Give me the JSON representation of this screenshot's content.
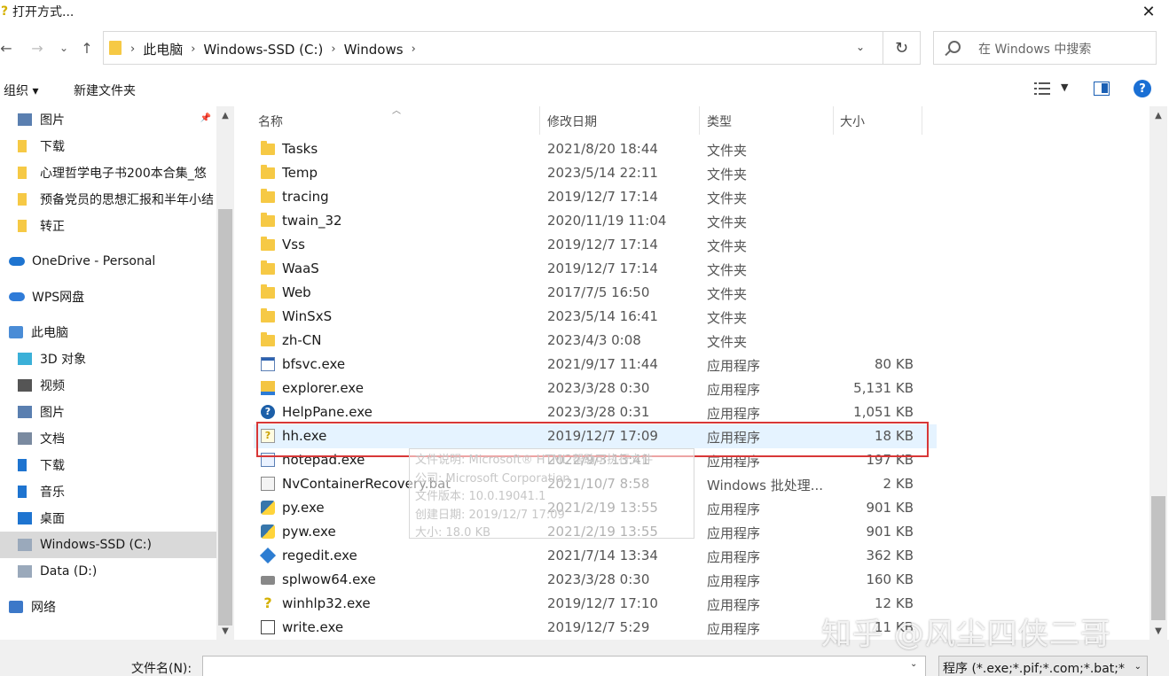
{
  "window": {
    "title": "打开方式...",
    "close_glyph": "✕"
  },
  "nav": {
    "back_glyph": "←",
    "forward_glyph": "→",
    "recent_glyph": "⌄",
    "up_glyph": "↑",
    "breadcrumbs": [
      "此电脑",
      "Windows-SSD (C:)",
      "Windows"
    ],
    "separator": "›",
    "refresh_glyph": "↻",
    "search_placeholder": "在 Windows 中搜索"
  },
  "toolbar": {
    "organize": "组织 ▾",
    "new_folder": "新建文件夹",
    "help": "?"
  },
  "sidebar": {
    "items": [
      {
        "label": "图片",
        "icon": "pictures-icon",
        "color": "#5a7fb0"
      },
      {
        "label": "下载",
        "icon": "folder-icon",
        "color": "#f6c945"
      },
      {
        "label": "心理哲学电子书200本合集_悠",
        "icon": "folder-icon",
        "color": "#f6c945"
      },
      {
        "label": "预备党员的思想汇报和半年小结",
        "icon": "folder-icon",
        "color": "#f6c945"
      },
      {
        "label": "转正",
        "icon": "folder-icon",
        "color": "#f6c945"
      },
      {
        "label": "OneDrive - Personal",
        "icon": "onedrive-icon",
        "color": "#1e74d0"
      },
      {
        "label": "WPS网盘",
        "icon": "wps-cloud-icon",
        "color": "#2f7bd8"
      },
      {
        "label": "此电脑",
        "icon": "this-pc-icon",
        "color": "#4a8cd6"
      },
      {
        "label": "3D 对象",
        "icon": "3d-objects-icon",
        "color": "#3bb0d8"
      },
      {
        "label": "视频",
        "icon": "videos-icon",
        "color": "#555555"
      },
      {
        "label": "图片",
        "icon": "pictures-icon",
        "color": "#5a7fb0"
      },
      {
        "label": "文档",
        "icon": "documents-icon",
        "color": "#7a8aa0"
      },
      {
        "label": "下载",
        "icon": "downloads-icon",
        "color": "#1e74d0"
      },
      {
        "label": "音乐",
        "icon": "music-icon",
        "color": "#1e74d0"
      },
      {
        "label": "桌面",
        "icon": "desktop-icon",
        "color": "#1e74d0"
      },
      {
        "label": "Windows-SSD (C:)",
        "icon": "drive-c-icon",
        "color": "#9aa9bb"
      },
      {
        "label": "Data (D:)",
        "icon": "drive-d-icon",
        "color": "#9aa9bb"
      },
      {
        "label": "网络",
        "icon": "network-icon",
        "color": "#3c78c8"
      }
    ]
  },
  "columns": {
    "name": "名称",
    "date": "修改日期",
    "type": "类型",
    "size": "大小"
  },
  "files": [
    {
      "name": "Tasks",
      "date": "2021/8/20 18:44",
      "type": "文件夹",
      "size": "",
      "icon": "folder"
    },
    {
      "name": "Temp",
      "date": "2023/5/14 22:11",
      "type": "文件夹",
      "size": "",
      "icon": "folder"
    },
    {
      "name": "tracing",
      "date": "2019/12/7 17:14",
      "type": "文件夹",
      "size": "",
      "icon": "folder"
    },
    {
      "name": "twain_32",
      "date": "2020/11/19 11:04",
      "type": "文件夹",
      "size": "",
      "icon": "folder"
    },
    {
      "name": "Vss",
      "date": "2019/12/7 17:14",
      "type": "文件夹",
      "size": "",
      "icon": "folder"
    },
    {
      "name": "WaaS",
      "date": "2019/12/7 17:14",
      "type": "文件夹",
      "size": "",
      "icon": "folder"
    },
    {
      "name": "Web",
      "date": "2017/7/5 16:50",
      "type": "文件夹",
      "size": "",
      "icon": "folder"
    },
    {
      "name": "WinSxS",
      "date": "2023/5/14 16:41",
      "type": "文件夹",
      "size": "",
      "icon": "folder"
    },
    {
      "name": "zh-CN",
      "date": "2023/4/3 0:08",
      "type": "文件夹",
      "size": "",
      "icon": "folder"
    },
    {
      "name": "bfsvc.exe",
      "date": "2021/9/17 11:44",
      "type": "应用程序",
      "size": "80 KB",
      "icon": "exe"
    },
    {
      "name": "explorer.exe",
      "date": "2023/3/28 0:30",
      "type": "应用程序",
      "size": "5,131 KB",
      "icon": "explorer"
    },
    {
      "name": "HelpPane.exe",
      "date": "2023/3/28 0:31",
      "type": "应用程序",
      "size": "1,051 KB",
      "icon": "help"
    },
    {
      "name": "hh.exe",
      "date": "2019/12/7 17:09",
      "type": "应用程序",
      "size": "18 KB",
      "icon": "hh"
    },
    {
      "name": "notepad.exe",
      "date": "2022/9/3 13:41",
      "type": "应用程序",
      "size": "197 KB",
      "icon": "note"
    },
    {
      "name": "NvContainerRecovery.bat",
      "date": "2021/10/7 8:58",
      "type": "Windows 批处理...",
      "size": "2 KB",
      "icon": "bat"
    },
    {
      "name": "py.exe",
      "date": "2021/2/19 13:55",
      "type": "应用程序",
      "size": "901 KB",
      "icon": "py"
    },
    {
      "name": "pyw.exe",
      "date": "2021/2/19 13:55",
      "type": "应用程序",
      "size": "901 KB",
      "icon": "py"
    },
    {
      "name": "regedit.exe",
      "date": "2021/7/14 13:34",
      "type": "应用程序",
      "size": "362 KB",
      "icon": "reg"
    },
    {
      "name": "splwow64.exe",
      "date": "2023/3/28 0:30",
      "type": "应用程序",
      "size": "160 KB",
      "icon": "print"
    },
    {
      "name": "winhlp32.exe",
      "date": "2019/12/7 17:10",
      "type": "应用程序",
      "size": "12 KB",
      "icon": "winhlp"
    },
    {
      "name": "write.exe",
      "date": "2019/12/7 5:29",
      "type": "应用程序",
      "size": "11 KB",
      "icon": "write"
    }
  ],
  "selected_file": "hh.exe",
  "tooltip": {
    "lines": [
      "文件说明: Microsoft® HTML 帮助可执行文件",
      "公司: Microsoft Corporation",
      "文件版本: 10.0.19041.1",
      "创建日期: 2019/12/7 17:09",
      "大小: 18.0 KB"
    ]
  },
  "bottom": {
    "filename_label": "文件名(N):",
    "filename_value": "",
    "filetype_value": "程序 (*.exe;*.pif;*.com;*.bat;*",
    "dropdown_glyph": "⌄"
  },
  "watermark": "知乎 @风尘四侠二哥",
  "colors": {
    "highlight": "#e5f3ff",
    "annotation_red": "#d83737",
    "selected_nav": "#d9d9d9",
    "accent": "#1a6fd4"
  }
}
